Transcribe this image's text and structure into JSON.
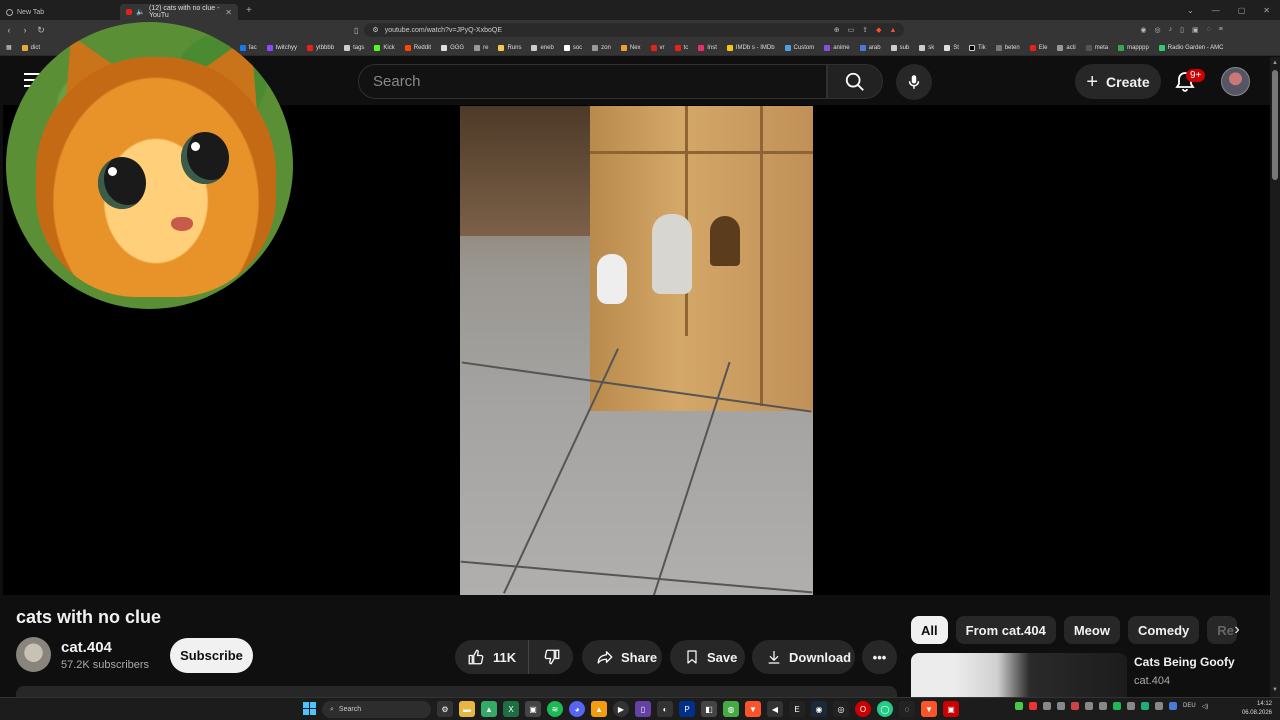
{
  "browser": {
    "tabs": [
      {
        "title": "New Tab",
        "active": false
      },
      {
        "title": "(12) cats with no clue - YouTu",
        "active": true
      }
    ],
    "url": "youtube.com/watch?v=JPyQ-XxboQE",
    "bookmarks": [
      "dict",
      "was",
      "fac",
      "twitchyy",
      "ytbbbb",
      "tags",
      "Kick",
      "Reddit",
      "GGG",
      "re",
      "Runs",
      "eneb",
      "soc",
      "zon",
      "Nex",
      "vr",
      "tc",
      "Inst",
      "IMDb s - IMDb",
      "Custom",
      "anime",
      "arab",
      "sub",
      "sk",
      "St",
      "Tik",
      "beten",
      "Ele",
      "acti",
      "meta",
      "mapppp",
      "Radio Garden - AMC"
    ]
  },
  "header": {
    "search_placeholder": "Search",
    "create_label": "Create",
    "notification_count": "9+"
  },
  "video": {
    "title": "cats with no clue",
    "channel": "cat.404",
    "subscribers": "57.2K subscribers",
    "subscribe_label": "Subscribe",
    "likes": "11K",
    "share_label": "Share",
    "save_label": "Save",
    "download_label": "Download",
    "more_label": "•••"
  },
  "sidebar": {
    "chips": [
      "All",
      "From cat.404",
      "Meow",
      "Comedy",
      "Re"
    ],
    "recommendation": {
      "title": "Cats Being Goofy",
      "channel": "cat.404"
    }
  },
  "taskbar": {
    "search_label": "Search",
    "language": "DEU",
    "time": "14:12",
    "date": "06.08.2026"
  },
  "colors": {
    "background": "#0f0f0f",
    "accent_red": "#cc0000",
    "chip_selected": "#f1f1f1",
    "surface": "#272727"
  }
}
